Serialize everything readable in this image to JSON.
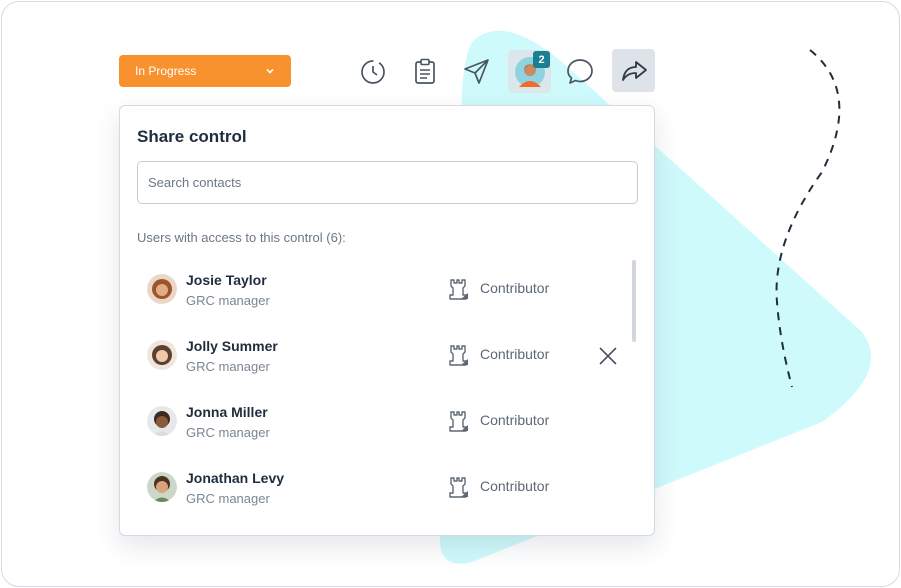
{
  "status_dropdown": {
    "label": "In Progress",
    "color": "#f7922f"
  },
  "toolbar": {
    "icons": [
      "history-icon",
      "clipboard-icon",
      "send-icon",
      "avatar",
      "comment-icon",
      "share-icon"
    ],
    "avatar_badge": "2"
  },
  "panel": {
    "title": "Share control",
    "search_placeholder": "Search contacts",
    "section_label": "Users with access to this control (6):"
  },
  "users": [
    {
      "name": "Josie Taylor",
      "title": "GRC manager",
      "role": "Contributor",
      "avatar_color": "#a0522d"
    },
    {
      "name": "Jolly Summer",
      "title": "GRC manager",
      "role": "Contributor",
      "avatar_color": "#5c4033"
    },
    {
      "name": "Jonna Miller",
      "title": "GRC manager",
      "role": "Contributor",
      "avatar_color": "#3b2a20"
    },
    {
      "name": "Jonathan Levy",
      "title": "GRC manager",
      "role": "Contributor",
      "avatar_color": "#4a3426"
    }
  ],
  "colors": {
    "accent_bg": "#cffafc",
    "badge": "#1a7f91"
  }
}
